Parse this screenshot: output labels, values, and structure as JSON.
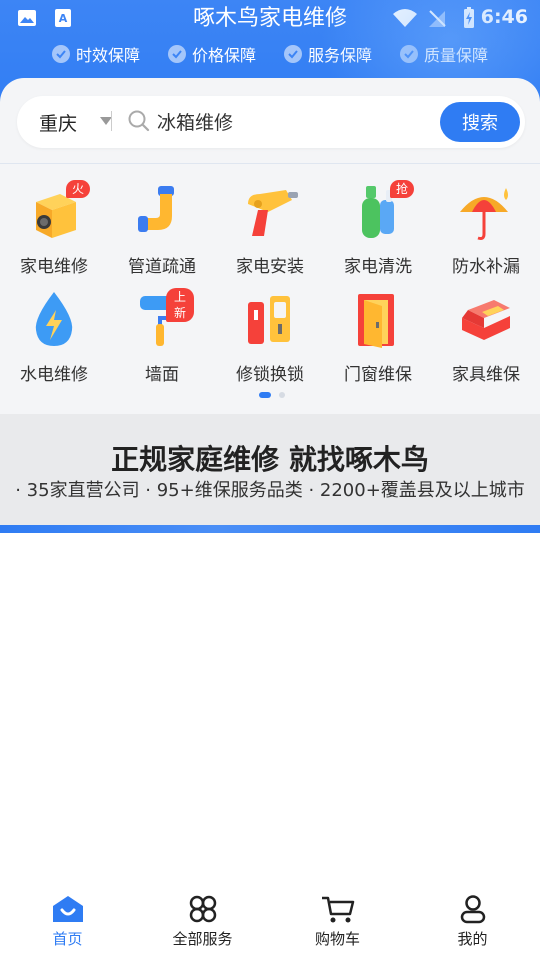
{
  "status_bar": {
    "time": "6:46"
  },
  "header": {
    "title": "啄木鸟家电维修",
    "guarantees": [
      "时效保障",
      "价格保障",
      "服务保障",
      "质量保障"
    ]
  },
  "search": {
    "city": "重庆",
    "query": "冰箱维修",
    "button": "搜索"
  },
  "categories": [
    {
      "label": "家电维修",
      "badge": "火",
      "icon": "washing-machine-icon"
    },
    {
      "label": "管道疏通",
      "badge": "",
      "icon": "pipe-icon"
    },
    {
      "label": "家电安装",
      "badge": "",
      "icon": "drill-icon"
    },
    {
      "label": "家电清洗",
      "badge": "抢",
      "icon": "spray-bottle-icon"
    },
    {
      "label": "防水补漏",
      "badge": "",
      "icon": "umbrella-icon"
    },
    {
      "label": "水电维修",
      "badge": "",
      "icon": "water-lightning-icon"
    },
    {
      "label": "墙面",
      "badge": "上新",
      "icon": "paint-roller-icon"
    },
    {
      "label": "修锁换锁",
      "badge": "",
      "icon": "door-lock-icon"
    },
    {
      "label": "门窗维保",
      "badge": "",
      "icon": "door-icon"
    },
    {
      "label": "家具维保",
      "badge": "",
      "icon": "sofa-icon"
    }
  ],
  "banner": {
    "title": "正规家庭维修  就找啄木鸟",
    "subtitle": "· 35家直营公司 · 95+维保服务品类 · 2200+覆盖县及以上城市"
  },
  "bottom_nav": [
    {
      "label": "首页",
      "icon": "home-icon",
      "active": true
    },
    {
      "label": "全部服务",
      "icon": "grid-icon",
      "active": false
    },
    {
      "label": "购物车",
      "icon": "cart-icon",
      "active": false
    },
    {
      "label": "我的",
      "icon": "profile-icon",
      "active": false
    }
  ],
  "colors": {
    "primary": "#2f7cf3",
    "badge": "#f5413a",
    "background": "#f4f5f7"
  }
}
